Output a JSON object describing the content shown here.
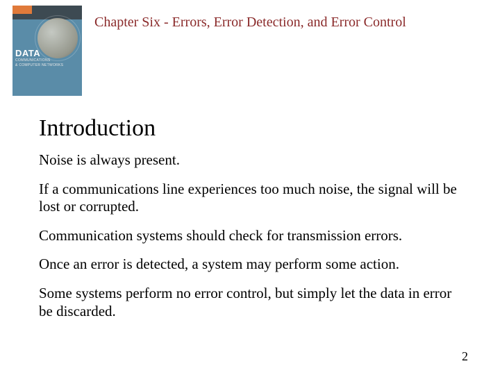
{
  "book": {
    "title": "DATA",
    "subtitle1": "COMMUNICATIONS",
    "subtitle2": "& COMPUTER NETWORKS"
  },
  "chapter_title": "Chapter Six - Errors, Error Detection, and Error Control",
  "section_title": "Introduction",
  "paragraphs": [
    "Noise is always present.",
    "If a communications line experiences too much noise, the signal will be lost or corrupted.",
    "Communication systems should check for transmission errors.",
    "Once an error is detected, a system may perform some action.",
    "Some systems perform no error control, but simply let the data in error be discarded."
  ],
  "page_number": "2"
}
